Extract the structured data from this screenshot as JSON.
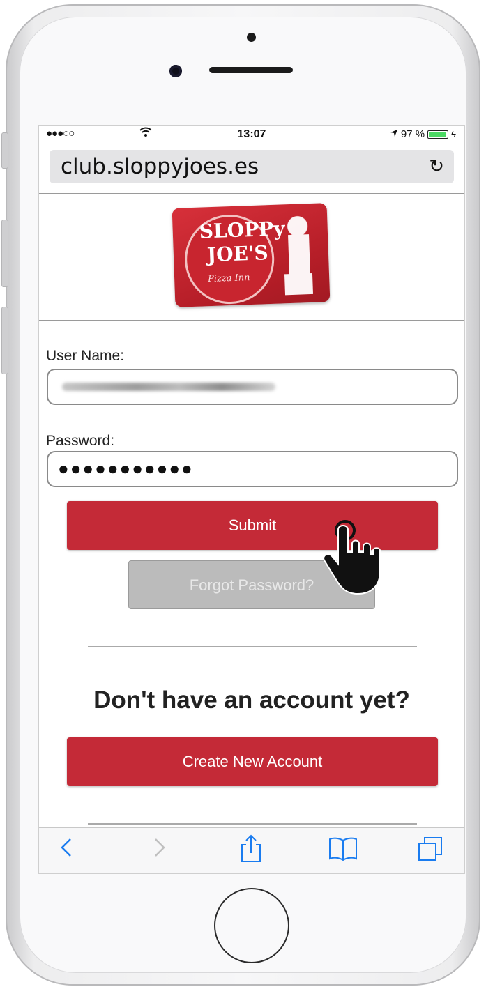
{
  "status_bar": {
    "signal": "●●●○○",
    "time": "13:07",
    "battery_percent": "97 %",
    "battery_level": 0.97
  },
  "browser": {
    "url": "club.sloppyjoes.es"
  },
  "logo": {
    "line1": "SLOPPy",
    "line2": "JOE'S",
    "line3": "Pizza Inn"
  },
  "login": {
    "username_label": "User Name:",
    "password_label": "Password:",
    "password_value": "●●●●●●●●●●●",
    "submit_label": "Submit",
    "forgot_label": "Forgot Password?"
  },
  "signup": {
    "headline": "Don't have an account yet?",
    "create_label": "Create New Account"
  },
  "colors": {
    "brand_red": "#c42a37",
    "disabled_gray": "#bbbbbb",
    "ios_blue": "#1a7cf0"
  },
  "icons": [
    "back-icon",
    "forward-icon",
    "share-icon",
    "bookmarks-icon",
    "tabs-icon",
    "reload-icon",
    "wifi-icon",
    "location-icon",
    "battery-icon",
    "hand-pointer-icon"
  ]
}
